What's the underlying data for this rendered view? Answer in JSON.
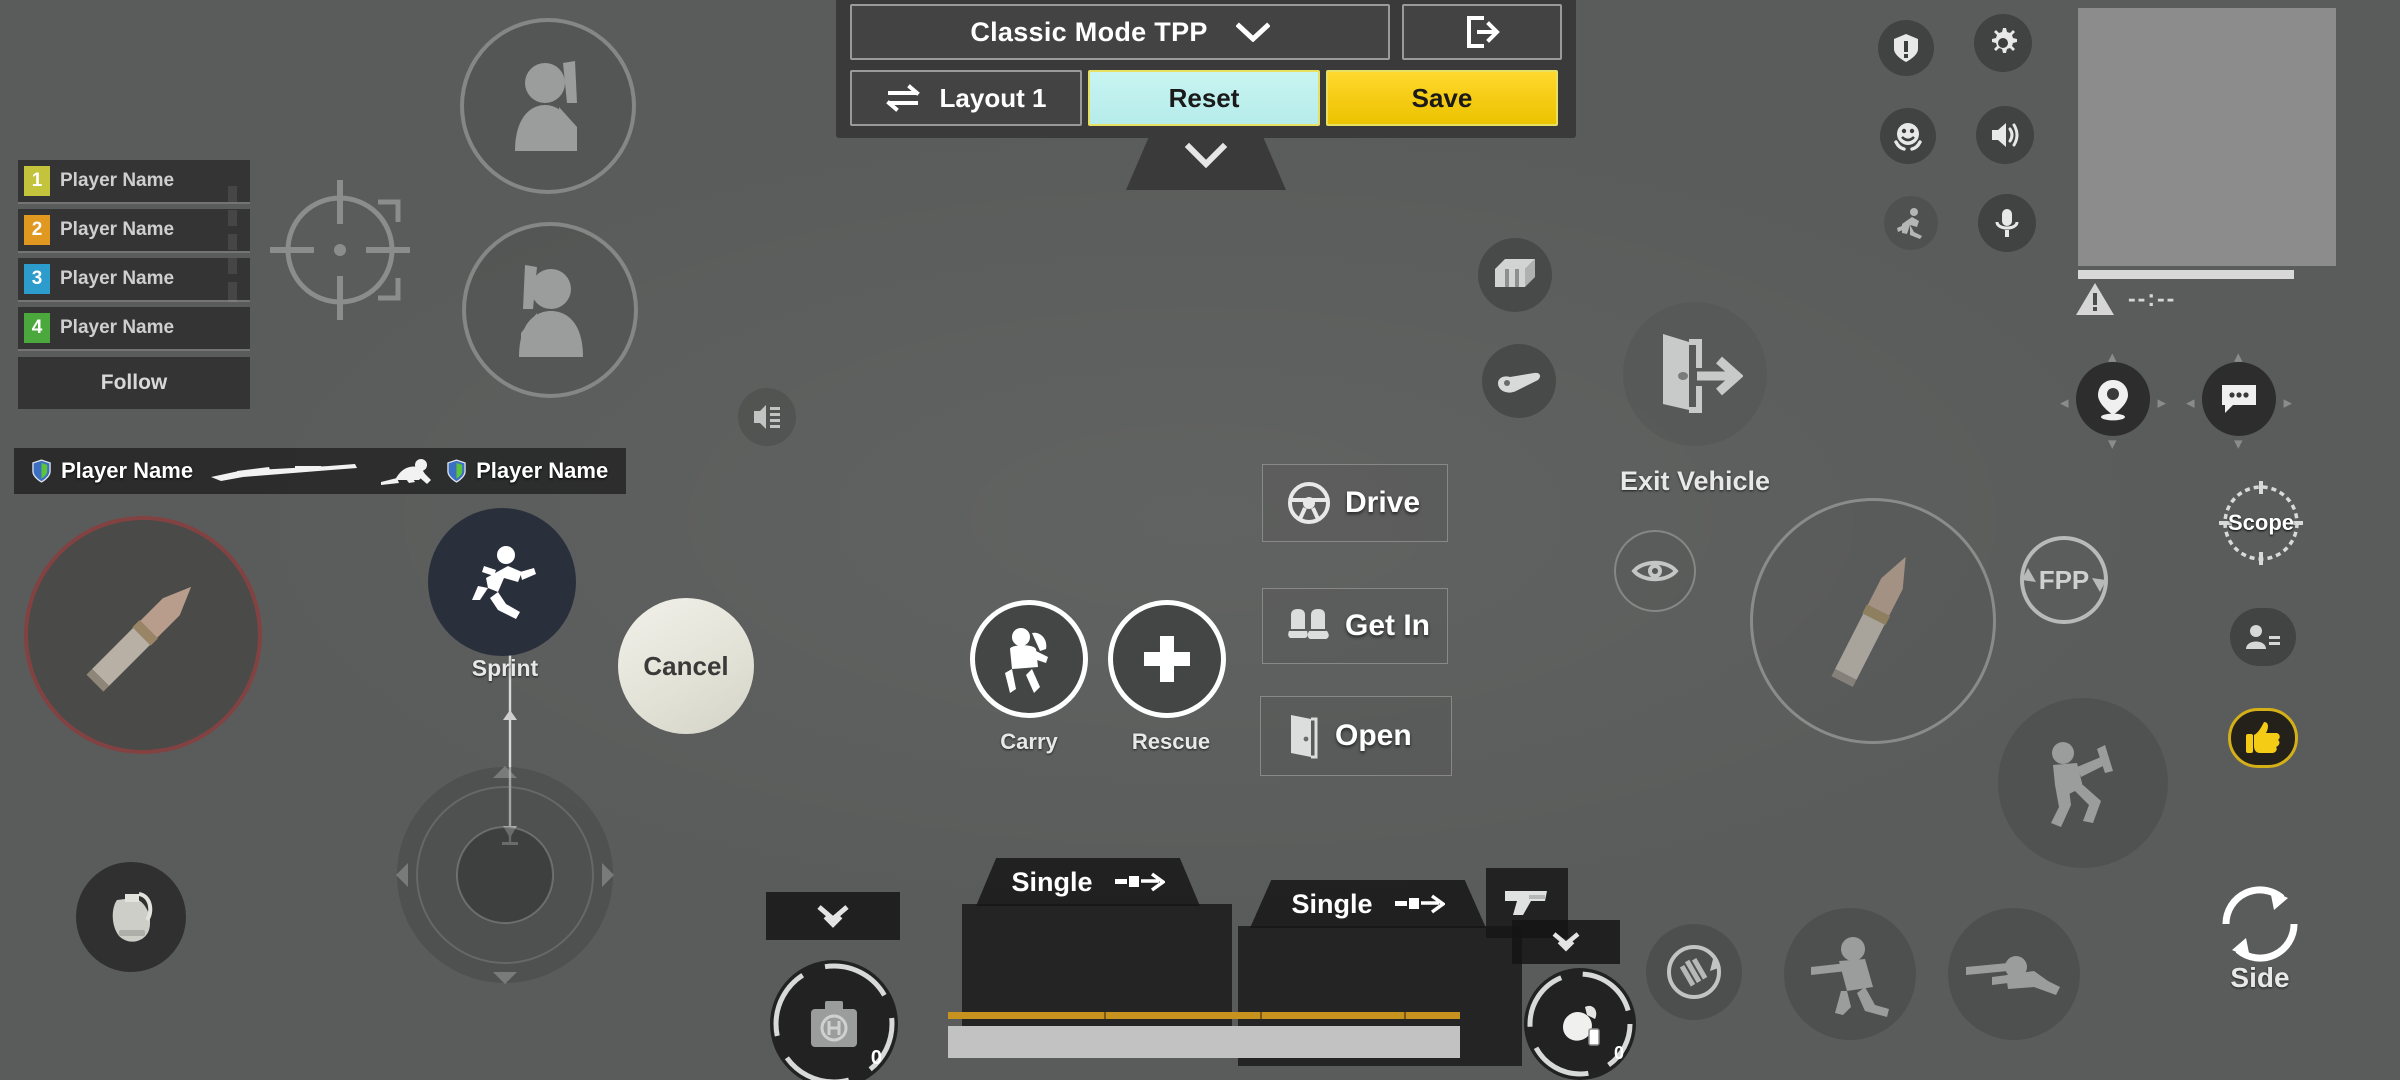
{
  "top_panel": {
    "mode_label": "Classic Mode TPP",
    "mode_caret_icon": "chevron-down-icon",
    "exit_icon": "exit-door-icon",
    "layout_label": "Layout 1",
    "layout_icon": "swap-arrows-icon",
    "reset_label": "Reset",
    "save_label": "Save",
    "collapse_icon": "chevron-down-icon",
    "accent_save": "#f5cc15",
    "accent_reset": "#bff0ee",
    "panel_bg": "#3a3a3a"
  },
  "team": {
    "rows": [
      {
        "num": "1",
        "name": "Player Name",
        "color": "#c4c43c"
      },
      {
        "num": "2",
        "name": "Player Name",
        "color": "#e09820"
      },
      {
        "num": "3",
        "name": "Player Name",
        "color": "#2b9ccc"
      },
      {
        "num": "4",
        "name": "Player Name",
        "color": "#4ba83c"
      }
    ],
    "follow_label": "Follow"
  },
  "kill_feed": {
    "killer_name": "Player Name",
    "victim_name": "Player Name",
    "weapon_icon": "rifle-icon",
    "knocked_icon": "knocked-player-icon",
    "shield_icon": "team-shield-icon"
  },
  "center_buttons": {
    "carry_label": "Carry",
    "carry_icon": "carry-player-icon",
    "rescue_label": "Rescue",
    "rescue_icon": "plus-icon",
    "drive_label": "Drive",
    "drive_icon": "steering-wheel-icon",
    "getin_label": "Get In",
    "getin_icon": "car-seats-icon",
    "open_label": "Open",
    "open_icon": "door-icon"
  },
  "movement": {
    "sprint_label": "Sprint",
    "sprint_icon": "running-figure-icon",
    "cancel_label": "Cancel",
    "joystick_icon": "directional-joystick"
  },
  "vehicle": {
    "exit_label": "Exit Vehicle",
    "exit_icon": "vehicle-exit-door-icon",
    "crate_icon": "supply-crate-icon",
    "hand_icon": "pointing-hand-icon",
    "peek_icon": "eye-peek-icon"
  },
  "right_rail": {
    "scope_label": "Scope",
    "scope_icon": "crosshair-scope-icon",
    "fpp_label": "FPP",
    "fpp_icon": "camera-rotate-icon",
    "side_label": "Side",
    "side_icon": "rotate-arrows-icon",
    "person_swap_icon": "person-swap-icon",
    "thumbs_up_icon": "thumbs-up-icon",
    "thumbs_up_color": "#f5cc15",
    "map_pin_icon": "map-pin-icon",
    "chat_icon": "chat-bubble-icon"
  },
  "top_right_icons": [
    {
      "name": "alert-shield-icon"
    },
    {
      "name": "gear-icon"
    },
    {
      "name": "emoji-smile-icon"
    },
    {
      "name": "speaker-icon"
    },
    {
      "name": "sprint-toggle-icon"
    },
    {
      "name": "microphone-icon"
    }
  ],
  "minimap": {
    "warning_icon": "warning-triangle-icon",
    "timer_text": "--:--"
  },
  "weapons": {
    "slot1": {
      "fire_mode": "Single",
      "mode_icon": "fire-rate-icon"
    },
    "slot2": {
      "fire_mode": "Single",
      "mode_icon": "fire-rate-icon",
      "weapon_icon": "pistol-icon"
    },
    "expand_left_icon": "chevron-double-down-icon",
    "expand_right_icon": "chevron-double-down-icon"
  },
  "items": {
    "medkit_icon": "medkit-icon",
    "medkit_count": "0",
    "smoke_icon": "smoke-grenade-icon",
    "smoke_count": "0",
    "grenade_icon": "grenade-icon",
    "reload_icon": "reload-ammo-icon",
    "crouch_icon": "crouch-figure-icon",
    "prone_icon": "prone-figure-icon",
    "jump_icon": "vault-jump-icon",
    "fire_left_icon": "bullet-icon",
    "fire_right_icon": "bullet-icon",
    "voice_toggle_icon": "voice-speaker-icon",
    "crosshair_icon": "crosshair-icon",
    "avatar_icon": "soldier-avatar-icon"
  }
}
